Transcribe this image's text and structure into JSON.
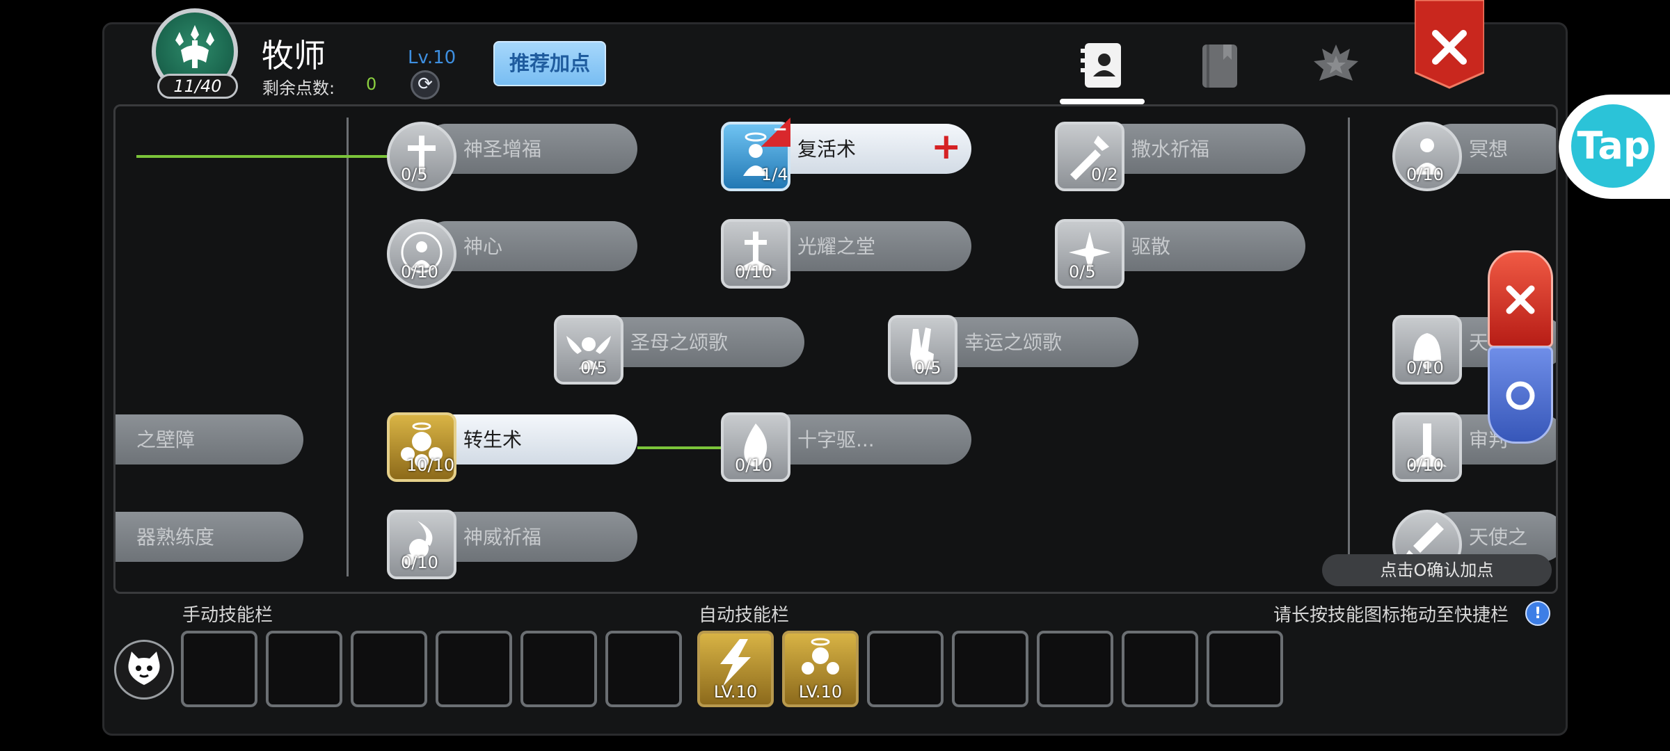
{
  "header": {
    "class_name": "牧师",
    "skill_points_used": "11/40",
    "remaining_label": "剩余点数:",
    "remaining_value": "0",
    "level": "Lv.10",
    "recommend_label": "推荐加点",
    "tabs": [
      "skill-book-icon",
      "book-icon",
      "emblem-icon"
    ],
    "active_tab": 0
  },
  "skills": [
    {
      "name": "神圣增福",
      "level": "0/5"
    },
    {
      "name": "复活术",
      "level": "1/4"
    },
    {
      "name": "撒水祈福",
      "level": "0/2"
    },
    {
      "name": "冥想",
      "level": "0/10"
    },
    {
      "name": "神心",
      "level": "0/10"
    },
    {
      "name": "光耀之堂",
      "level": "0/10"
    },
    {
      "name": "驱散",
      "level": "0/5"
    },
    {
      "name": "圣母之颂歌",
      "level": "0/5"
    },
    {
      "name": "幸运之颂歌",
      "level": "0/5"
    },
    {
      "name": "天",
      "level": "0/10"
    },
    {
      "name": "之壁障",
      "level": ""
    },
    {
      "name": "转生术",
      "level": "10/10"
    },
    {
      "name": "十字驱...",
      "level": "0/10"
    },
    {
      "name": "审判",
      "level": "0/10"
    },
    {
      "name": "器熟练度",
      "level": ""
    },
    {
      "name": "神威祈福",
      "level": "0/10"
    },
    {
      "name": "天使之",
      "level": ""
    }
  ],
  "confirm_hint": "点击O确认加点",
  "bottom": {
    "manual_label": "手动技能栏",
    "auto_label": "自动技能栏",
    "drag_hint": "请长按技能图标拖动至快捷栏",
    "info_icon": "!",
    "auto_slots": [
      {
        "level": "LV.10"
      },
      {
        "level": "LV.10"
      }
    ]
  },
  "overlay": {
    "tap_label": "Tap"
  },
  "colors": {
    "accent_green": "#7bc43a",
    "level_blue": "#3e8fe0",
    "close_red": "#d52124"
  }
}
